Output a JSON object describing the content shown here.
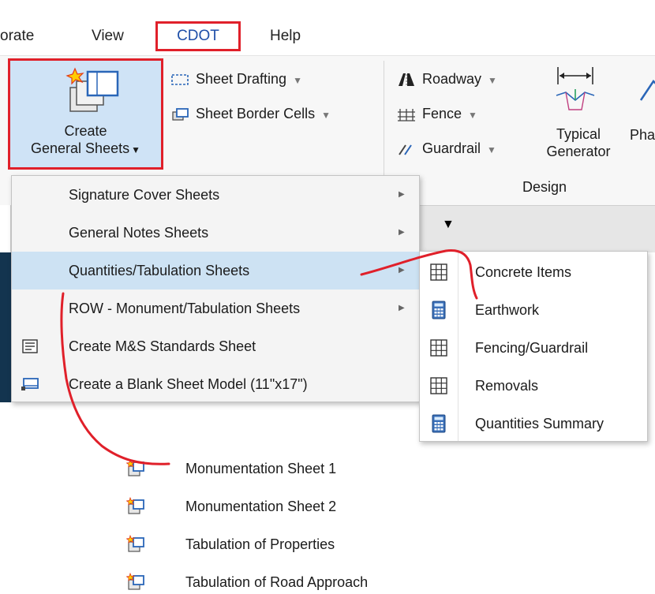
{
  "menubar": {
    "tabs": [
      {
        "label": "orate"
      },
      {
        "label": "View"
      },
      {
        "label": "CDOT"
      },
      {
        "label": "Help"
      }
    ]
  },
  "ribbon": {
    "create_button": {
      "line1": "Create",
      "line2": "General Sheets"
    },
    "sheet_drafting": "Sheet Drafting",
    "sheet_border_cells": "Sheet Border Cells",
    "roadway": "Roadway",
    "fence": "Fence",
    "guardrail": "Guardrail",
    "typical_generator": {
      "line1": "Typical",
      "line2": "Generator"
    },
    "partial_label": "Pha",
    "group_design": "Design"
  },
  "main_menu": {
    "items": [
      {
        "label": "Signature Cover Sheets",
        "has_submenu": true
      },
      {
        "label": "General Notes Sheets",
        "has_submenu": true
      },
      {
        "label": "Quantities/Tabulation Sheets",
        "has_submenu": true,
        "highlighted": true
      },
      {
        "label": "ROW - Monument/Tabulation Sheets",
        "has_submenu": true
      },
      {
        "label": "Create M&S Standards Sheet",
        "icon": "document-list-icon"
      },
      {
        "label": "Create a Blank Sheet Model (11\"x17\")",
        "icon": "sheet-model-icon"
      }
    ]
  },
  "quantities_submenu": {
    "items": [
      {
        "label": "Concrete Items",
        "icon": "table-grid-icon"
      },
      {
        "label": "Earthwork",
        "icon": "calculator-icon"
      },
      {
        "label": "Fencing/Guardrail",
        "icon": "table-grid-icon"
      },
      {
        "label": "Removals",
        "icon": "table-grid-icon"
      },
      {
        "label": "Quantities Summary",
        "icon": "calculator-icon"
      }
    ]
  },
  "row_submenu": {
    "items": [
      {
        "label": "Monumentation Sheet 1"
      },
      {
        "label": "Monumentation Sheet 2"
      },
      {
        "label": "Tabulation of Properties"
      },
      {
        "label": "Tabulation of Road Approach"
      }
    ]
  },
  "colors": {
    "highlight_red": "#e0202a",
    "selection_blue": "#cde2f3",
    "button_blue": "#cfe3f6"
  }
}
